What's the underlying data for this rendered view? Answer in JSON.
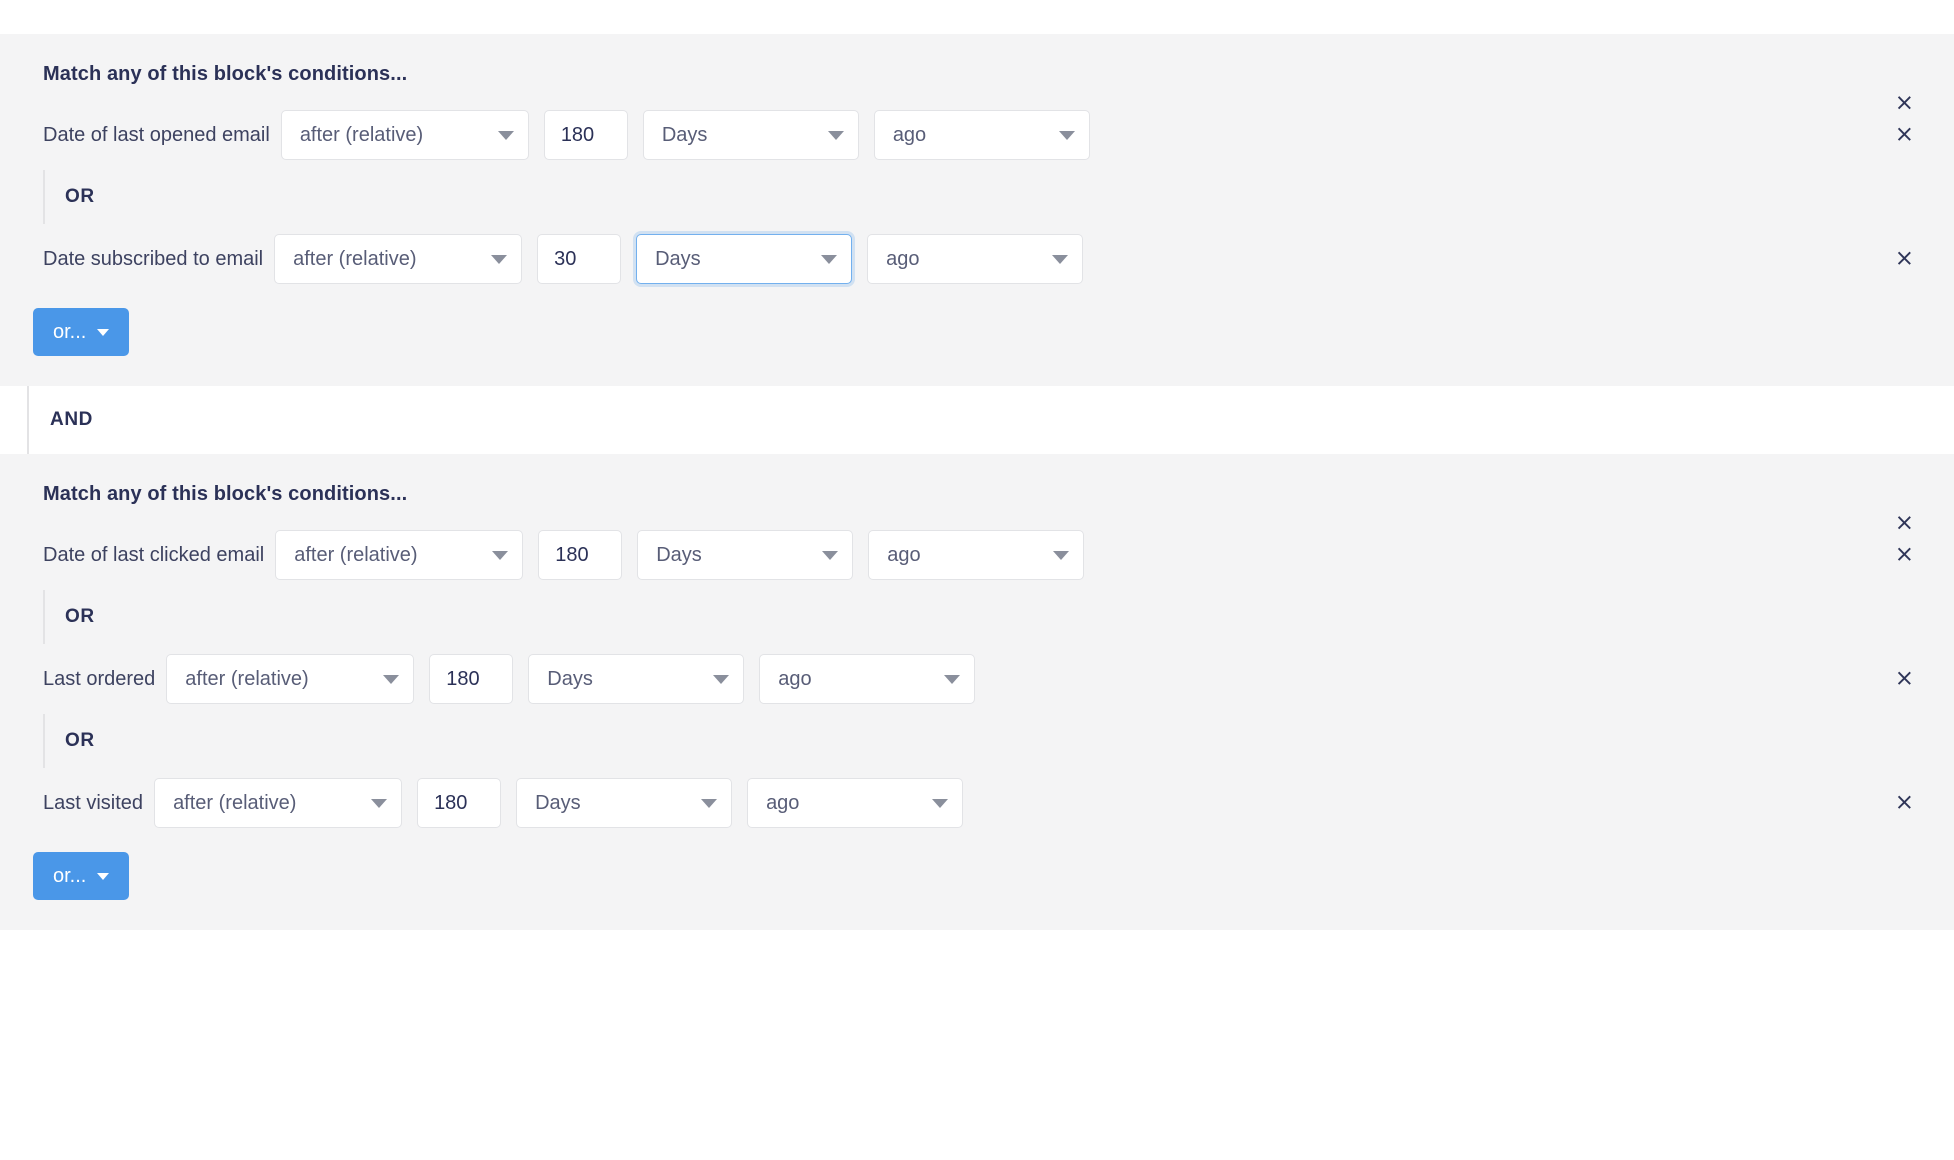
{
  "ui": {
    "accent_color": "#4a97e8",
    "block_background": "#f4f4f5",
    "text_color": "#2b3157",
    "focus_border_color": "#73b0ee",
    "close_icon": "×",
    "and_label": "AND",
    "or_label": "OR",
    "add_or_button_label": "or...",
    "block_title": "Match any of this block's conditions..."
  },
  "blocks": [
    {
      "title": "Match any of this block's conditions...",
      "conditions": [
        {
          "field": "Date of last opened email",
          "operator": "after (relative)",
          "amount": "180",
          "unit": "Days",
          "direction": "ago",
          "focused_control": "",
          "operator_width": 248,
          "amount_width": 84,
          "unit_width": 216,
          "direction_width": 216
        },
        {
          "field": "Date subscribed to email",
          "operator": "after (relative)",
          "amount": "30",
          "unit": "Days",
          "direction": "ago",
          "focused_control": "unit",
          "operator_width": 248,
          "amount_width": 84,
          "unit_width": 216,
          "direction_width": 216
        }
      ],
      "add_button_label": "or..."
    },
    {
      "title": "Match any of this block's conditions...",
      "conditions": [
        {
          "field": "Date of last clicked email",
          "operator": "after (relative)",
          "amount": "180",
          "unit": "Days",
          "direction": "ago",
          "focused_control": "",
          "operator_width": 248,
          "amount_width": 84,
          "unit_width": 216,
          "direction_width": 216
        },
        {
          "field": "Last ordered",
          "operator": "after (relative)",
          "amount": "180",
          "unit": "Days",
          "direction": "ago",
          "focused_control": "",
          "operator_width": 248,
          "amount_width": 84,
          "unit_width": 216,
          "direction_width": 216
        },
        {
          "field": "Last visited",
          "operator": "after (relative)",
          "amount": "180",
          "unit": "Days",
          "direction": "ago",
          "focused_control": "",
          "operator_width": 248,
          "amount_width": 84,
          "unit_width": 216,
          "direction_width": 216
        }
      ],
      "add_button_label": "or..."
    }
  ],
  "separators": {
    "between_blocks": "AND",
    "between_conditions": "OR"
  }
}
